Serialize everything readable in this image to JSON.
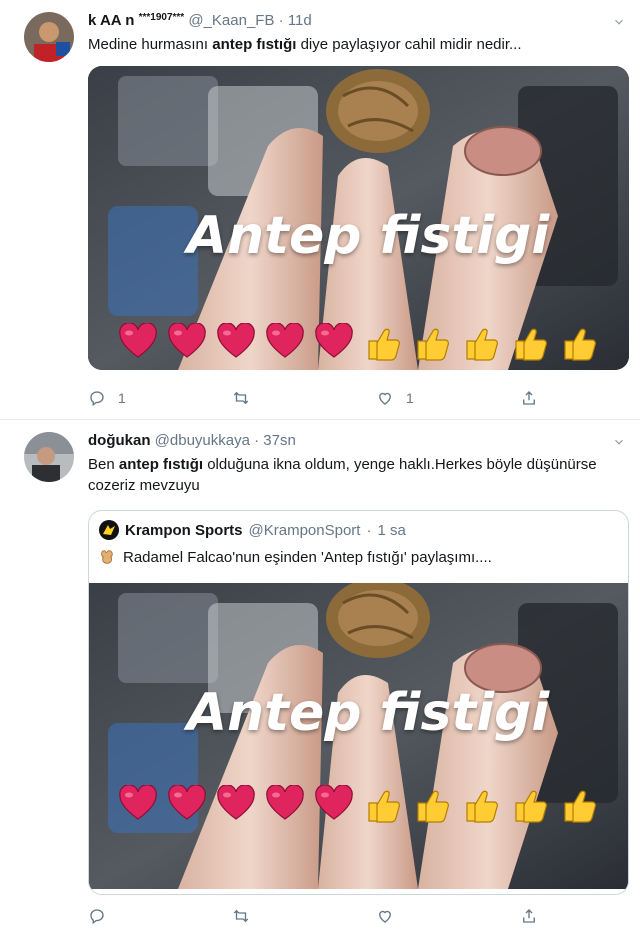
{
  "tweet1": {
    "author_name": "k AA n",
    "author_badge": "***1907***",
    "handle": "@_Kaan_FB",
    "separator": "·",
    "time": "11d",
    "text_before": "Medine hurmasını ",
    "text_bold": "antep fıstığı",
    "text_after": " diye paylaşıyor cahil midir nedir...",
    "image_overlay": "Antep fistigi",
    "reply_count": "1",
    "retweet_count": "",
    "like_count": "1"
  },
  "tweet2": {
    "author_name": "doğukan",
    "handle": "@dbuyukkaya",
    "separator": "·",
    "time": "37sn",
    "text_before": "Ben ",
    "text_bold": "antep fıstığı",
    "text_after": " olduğuna ikna oldum, yenge haklı.Herkes böyle düşünürse cozeriz mevzuyu",
    "quote": {
      "author_name": "Krampon Sports",
      "handle": "@KramponSport",
      "separator": "·",
      "time": "1 sa",
      "text": "Radamel Falcao'nun eşinden 'Antep fıstığı' paylaşımı....",
      "image_overlay": "Antep fistigi"
    }
  },
  "icons": [
    "reply-icon",
    "retweet-icon",
    "like-icon",
    "share-icon",
    "chevron-down-icon",
    "peanut-emoji-icon",
    "heart-emoji-icon",
    "thumbs-up-emoji-icon"
  ],
  "colors": {
    "secondary_text": "#657786",
    "border": "#e6ecf0",
    "heart": "#e0245e",
    "thumb": "#ffcc33"
  }
}
